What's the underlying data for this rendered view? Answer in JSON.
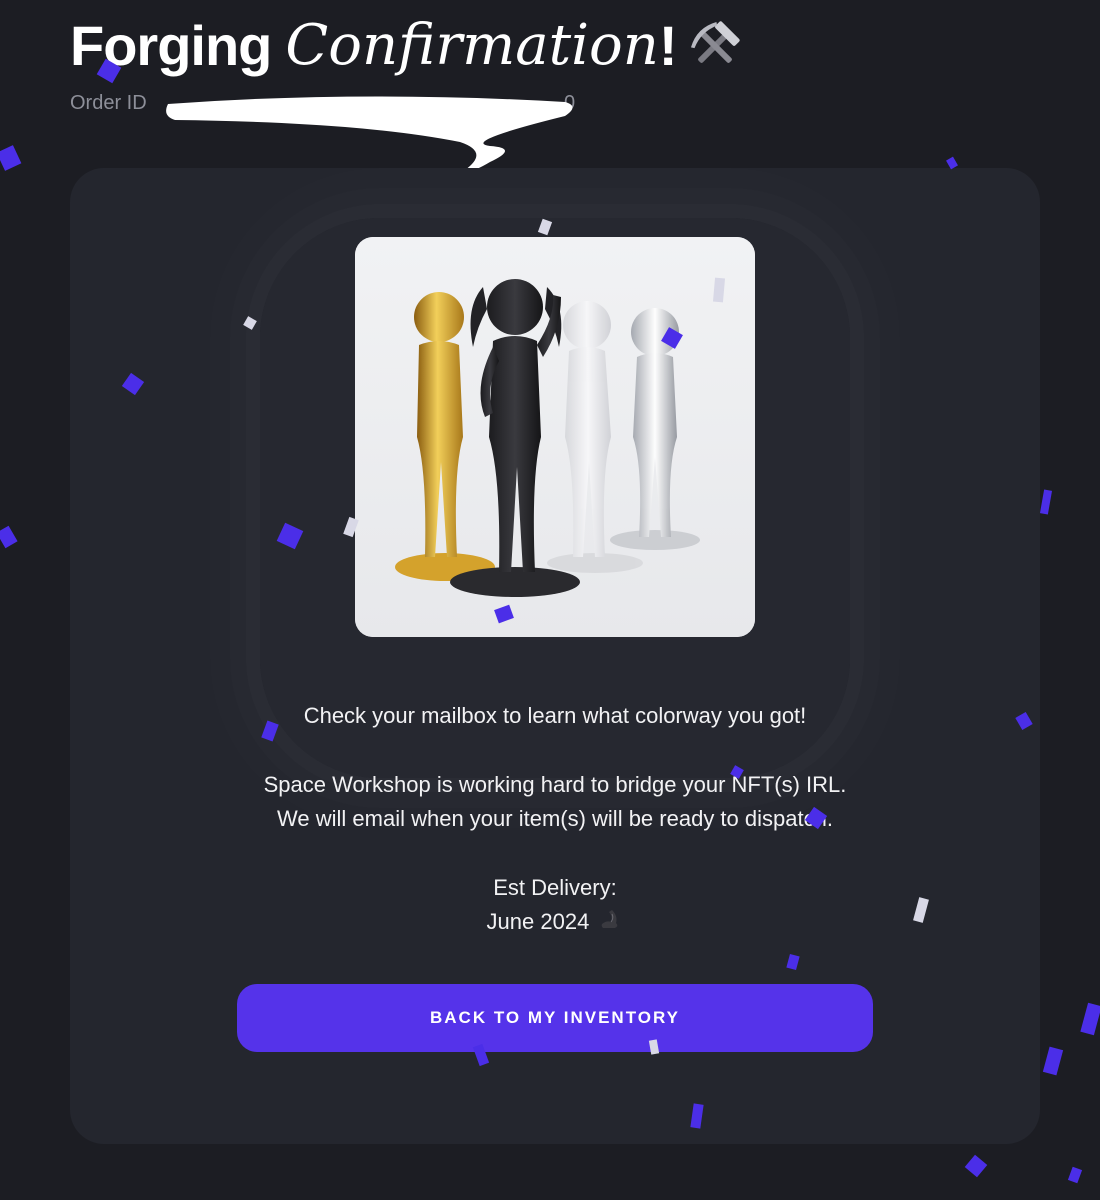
{
  "header": {
    "title_bold": "Forging",
    "title_serif": "Confirmation",
    "title_bang": "!",
    "title_icon": "hammer-and-pick-icon",
    "order_label": "Order ID",
    "order_id_tail": "0"
  },
  "card": {
    "image_icon": "figure-colorways-photo",
    "message_line1": "Check your mailbox to learn what colorway you got!",
    "message_line2": "Space Workshop is working hard to bridge your NFT(s) IRL.",
    "message_line3": "We will email when your item(s) will be ready to dispatch.",
    "delivery_label": "Est Delivery:",
    "delivery_date": "June 2024",
    "delivery_icon": "flexed-biceps-icon",
    "cta_label": "BACK TO MY INVENTORY"
  },
  "colors": {
    "background": "#1c1d23",
    "card": "#24262e",
    "accent": "#5533ea",
    "confetti_primary": "#4b2ee8",
    "confetti_secondary": "#d8d8e6"
  }
}
